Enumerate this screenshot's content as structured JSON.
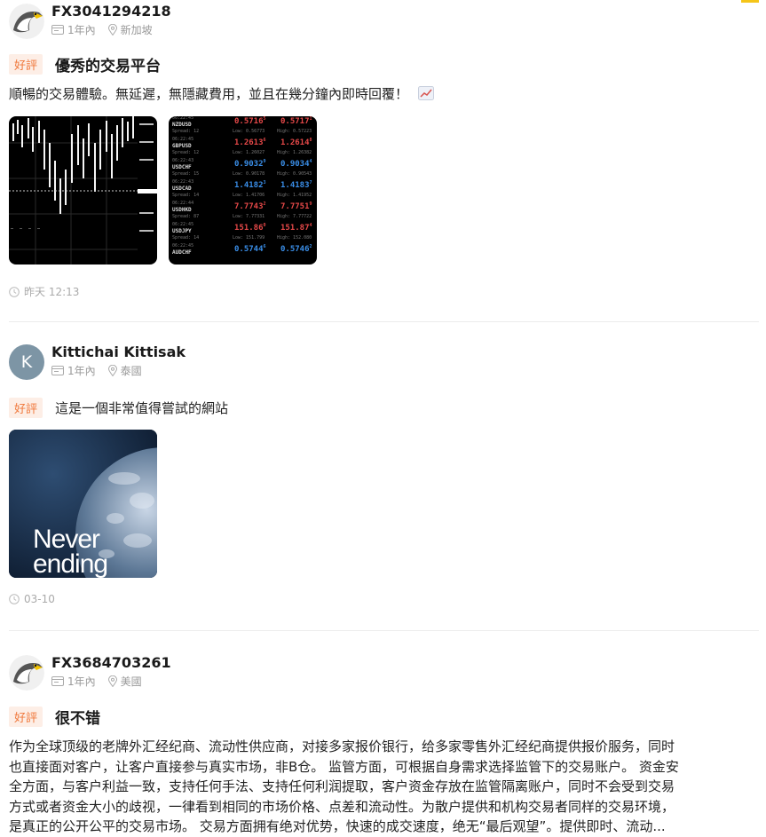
{
  "reviews": [
    {
      "user": "FX3041294218",
      "period": "1年內",
      "location": "新加坡",
      "tag": "好評",
      "title": "優秀的交易平台",
      "text": "順暢的交易體驗。無延遲，無隱藏費用，並且在幾分鐘內即時回覆！",
      "time": "昨天 12:13",
      "quotes": [
        {
          "time": "06:22:45",
          "symbol": "NZDUSD",
          "bid": "0.5716",
          "bid_sup": "5",
          "ask": "0.5717",
          "ask_sup": "1",
          "sub_left": "Spread: 12",
          "sub_mid": "Low: 0.56773",
          "sub_right": "High: 0.57223",
          "color": "red"
        },
        {
          "time": "06:22:45",
          "symbol": "GBPUSD",
          "bid": "1.2613",
          "bid_sup": "6",
          "ask": "1.2614",
          "ask_sup": "8",
          "sub_left": "Spread: 12",
          "sub_mid": "Low: 1.26027",
          "sub_right": "High: 1.26382",
          "color": "red"
        },
        {
          "time": "06:22:43",
          "symbol": "USDCHF",
          "bid": "0.9032",
          "bid_sup": "9",
          "ask": "0.9034",
          "ask_sup": "4",
          "sub_left": "Spread: 15",
          "sub_mid": "Low: 0.90178",
          "sub_right": "High: 0.90543",
          "color": "blue"
        },
        {
          "time": "06:22:43",
          "symbol": "USDCAD",
          "bid": "1.4182",
          "bid_sup": "3",
          "ask": "1.4183",
          "ask_sup": "7",
          "sub_left": "Spread: 14",
          "sub_mid": "Low: 1.41706",
          "sub_right": "High: 1.41952",
          "color": "blue"
        },
        {
          "time": "06:22:44",
          "symbol": "USDHKD",
          "bid": "7.7743",
          "bid_sup": "2",
          "ask": "7.7751",
          "ask_sup": "9",
          "sub_left": "Spread: 87",
          "sub_mid": "Low: 7.77331",
          "sub_right": "High: 7.77722",
          "color": "red"
        },
        {
          "time": "06:22:45",
          "symbol": "USDJPY",
          "bid": "151.86",
          "bid_sup": "0",
          "ask": "151.87",
          "ask_sup": "4",
          "sub_left": "Spread: 14",
          "sub_mid": "Low: 151.799",
          "sub_right": "High: 152.080",
          "color": "red"
        },
        {
          "time": "06:22:45",
          "symbol": "AUDCHF",
          "bid": "0.5744",
          "bid_sup": "6",
          "ask": "0.5746",
          "ask_sup": "2",
          "sub_left": "",
          "sub_mid": "",
          "sub_right": "",
          "color": "blue"
        }
      ]
    },
    {
      "user": "Kittichai Kittisak",
      "avatar_letter": "K",
      "period": "1年內",
      "location": "泰國",
      "tag": "好評",
      "text": "這是一個非常值得嘗試的網站",
      "image_text_1": "Never",
      "image_text_2": "ending",
      "time": "03-10"
    },
    {
      "user": "FX3684703261",
      "period": "1年內",
      "location": "美國",
      "tag": "好評",
      "title": "很不错",
      "lines": [
        "作为全球顶级的老牌外汇经纪商、流动性供应商，对接多家报价银行，给多家零售外汇经纪商提供报价服务，同时",
        "也直接面对客户，让客户直接参与真实市场，非B仓。 监管方面，可根据自身需求选择监管下的交易账户。 资金安",
        "全方面，与客户利益一致，支持任何手法、支持任何利润提取，客户资金存放在监管隔离账户，同时不会受到交易",
        "方式或者资金大小的歧视，一律看到相同的市场价格、点差和流动性。为散户提供和机构交易者同样的交易环境，",
        "是真正的公开公平的交易市场。 交易方面拥有绝对优势，快速的成交速度，绝无“最后观望”。提供即时、流动..."
      ]
    }
  ],
  "colors": {
    "tag_text": "#f0773a",
    "tag_bg": "#fdeee6",
    "meta": "#999999",
    "divider": "#ececec",
    "accent": "#f5c518"
  }
}
